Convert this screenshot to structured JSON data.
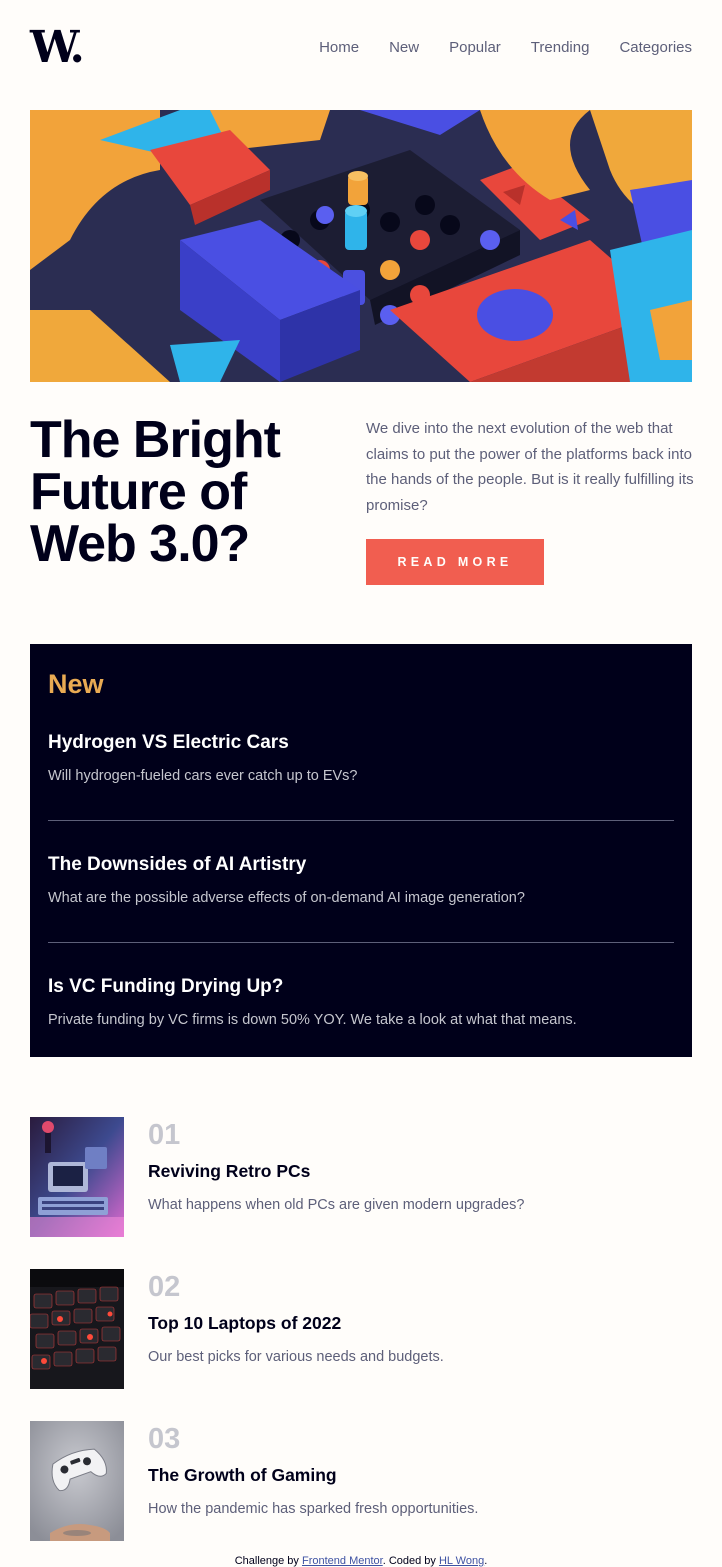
{
  "header": {
    "logo": "W.",
    "nav": [
      "Home",
      "New",
      "Popular",
      "Trending",
      "Categories"
    ]
  },
  "hero": {
    "image_icon": "abstract-3d-blocks-illustration",
    "headline": "The Bright Future of Web 3.0?",
    "description": "We dive into the next evolution of the web that claims to put the power of the platforms back into the hands of the people. But is it really fulfilling its promise?",
    "cta_label": "READ MORE"
  },
  "new_panel": {
    "title": "New",
    "items": [
      {
        "title": "Hydrogen VS Electric Cars",
        "text": "Will hydrogen-fueled cars ever catch up to EVs?"
      },
      {
        "title": "The Downsides of AI Artistry",
        "text": "What are the possible adverse effects of on-demand AI image generation?"
      },
      {
        "title": "Is VC Funding Drying Up?",
        "text": "Private funding by VC firms is down 50% YOY. We take a look at what that means."
      }
    ]
  },
  "ranked": [
    {
      "number": "01",
      "title": "Reviving Retro PCs",
      "text": "What happens when old PCs are given modern upgrades?",
      "image_icon": "retro-pc-image"
    },
    {
      "number": "02",
      "title": "Top 10 Laptops of 2022",
      "text": "Our best picks for various needs and budgets.",
      "image_icon": "laptop-keyboard-image"
    },
    {
      "number": "03",
      "title": "The Growth of Gaming",
      "text": "How the pandemic has sparked fresh opportunities.",
      "image_icon": "game-controller-image"
    }
  ],
  "footer": {
    "prefix": "Challenge by ",
    "link1": "Frontend Mentor",
    "middle": ". Coded by ",
    "link2": "HL Wong",
    "suffix": "."
  },
  "colors": {
    "accent": "#f15e50",
    "new_title": "#e9ab53",
    "dark": "#00001a",
    "muted": "#5d5f79",
    "bg": "#fffdfa"
  }
}
